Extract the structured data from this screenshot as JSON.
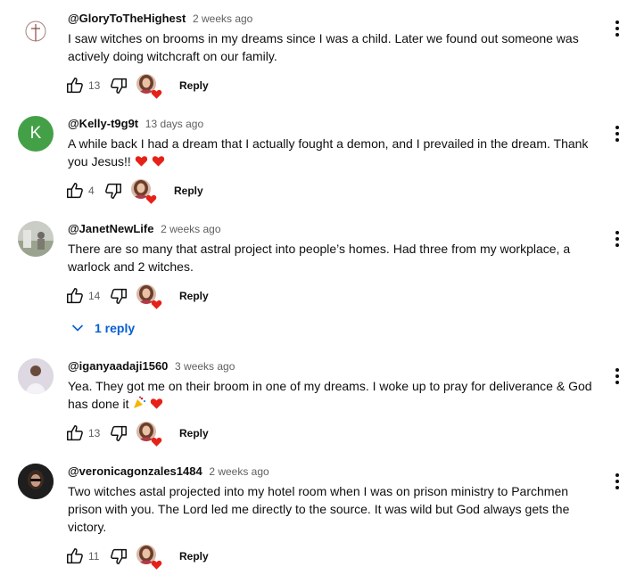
{
  "comments": [
    {
      "author": "@GloryToTheHighest",
      "time": "2 weeks ago",
      "line1": "I saw witches on brooms in my dreams since I was a child. Later we found out someone was",
      "line2": "actively doing witchcraft on our family.",
      "likes": "13",
      "reply_label": "Reply",
      "avatar_icon": "cross-icon"
    },
    {
      "author": "@Kelly-t9g9t",
      "time": "13 days ago",
      "line1": "A while back I had a dream that I actually fought a demon, and I prevailed in the dream. Thank",
      "line2": "you Jesus!!",
      "likes": "4",
      "reply_label": "Reply",
      "avatar_letter": "K",
      "avatar_color": "#43a047"
    },
    {
      "author": "@JanetNewLife",
      "time": "2 weeks ago",
      "line1": "There are so many that astral project into people’s homes. Had three from my workplace, a",
      "line2": "warlock and 2 witches.",
      "likes": "14",
      "reply_label": "Reply",
      "replies_label": "1 reply"
    },
    {
      "author": "@iganyaadaji1560",
      "time": "3 weeks ago",
      "line1": "Yea. They got me on their broom in one of my dreams. I woke up to pray for deliverance & God",
      "line2": "has done it",
      "likes": "13",
      "reply_label": "Reply"
    },
    {
      "author": "@veronicagonzales1484",
      "time": "2 weeks ago",
      "line1": "Two witches astal projected into my hotel room when I was on prison ministry to Parchmen",
      "line2": "prison with you. The Lord led me directly to the source. It was wild but God always gets the",
      "line3": "victory.",
      "likes": "11",
      "reply_label": "Reply"
    }
  ],
  "colors": {
    "link_blue": "#065fd4",
    "heart_red": "#e62117",
    "meta_gray": "#606060"
  }
}
